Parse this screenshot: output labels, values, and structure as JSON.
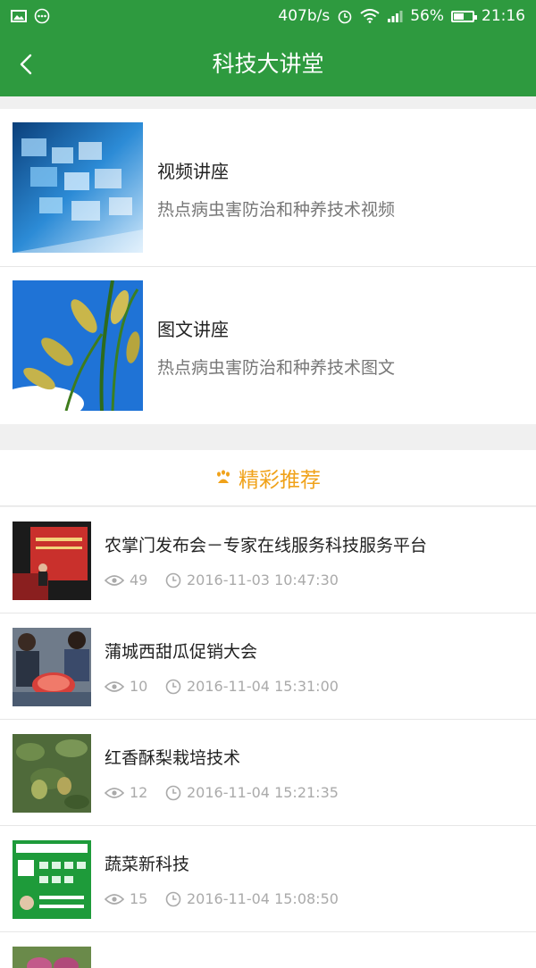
{
  "status_bar": {
    "speed": "407b/s",
    "battery": "56%",
    "battery_level": 0.56,
    "time": "21:16"
  },
  "header": {
    "title": "科技大讲堂",
    "back_icon": "chevron-left-icon"
  },
  "lectures": [
    {
      "title": "视频讲座",
      "subtitle": "热点病虫害防治和种养技术视频"
    },
    {
      "title": "图文讲座",
      "subtitle": "热点病虫害防治和种养技术图文"
    }
  ],
  "recommend": {
    "label": "精彩推荐",
    "icon": "paw-icon",
    "color": "#f0a21a"
  },
  "news": [
    {
      "title": "农掌门发布会－专家在线服务科技服务平台",
      "views": "49",
      "time": "2016-11-03 10:47:30"
    },
    {
      "title": "蒲城西甜瓜促销大会",
      "views": "10",
      "time": "2016-11-04 15:31:00"
    },
    {
      "title": "红香酥梨栽培技术",
      "views": "12",
      "time": "2016-11-04 15:21:35"
    },
    {
      "title": "蔬菜新科技",
      "views": "15",
      "time": "2016-11-04 15:08:50"
    }
  ],
  "colors": {
    "brand": "#2e9a3f",
    "accent": "#f0a21a"
  }
}
